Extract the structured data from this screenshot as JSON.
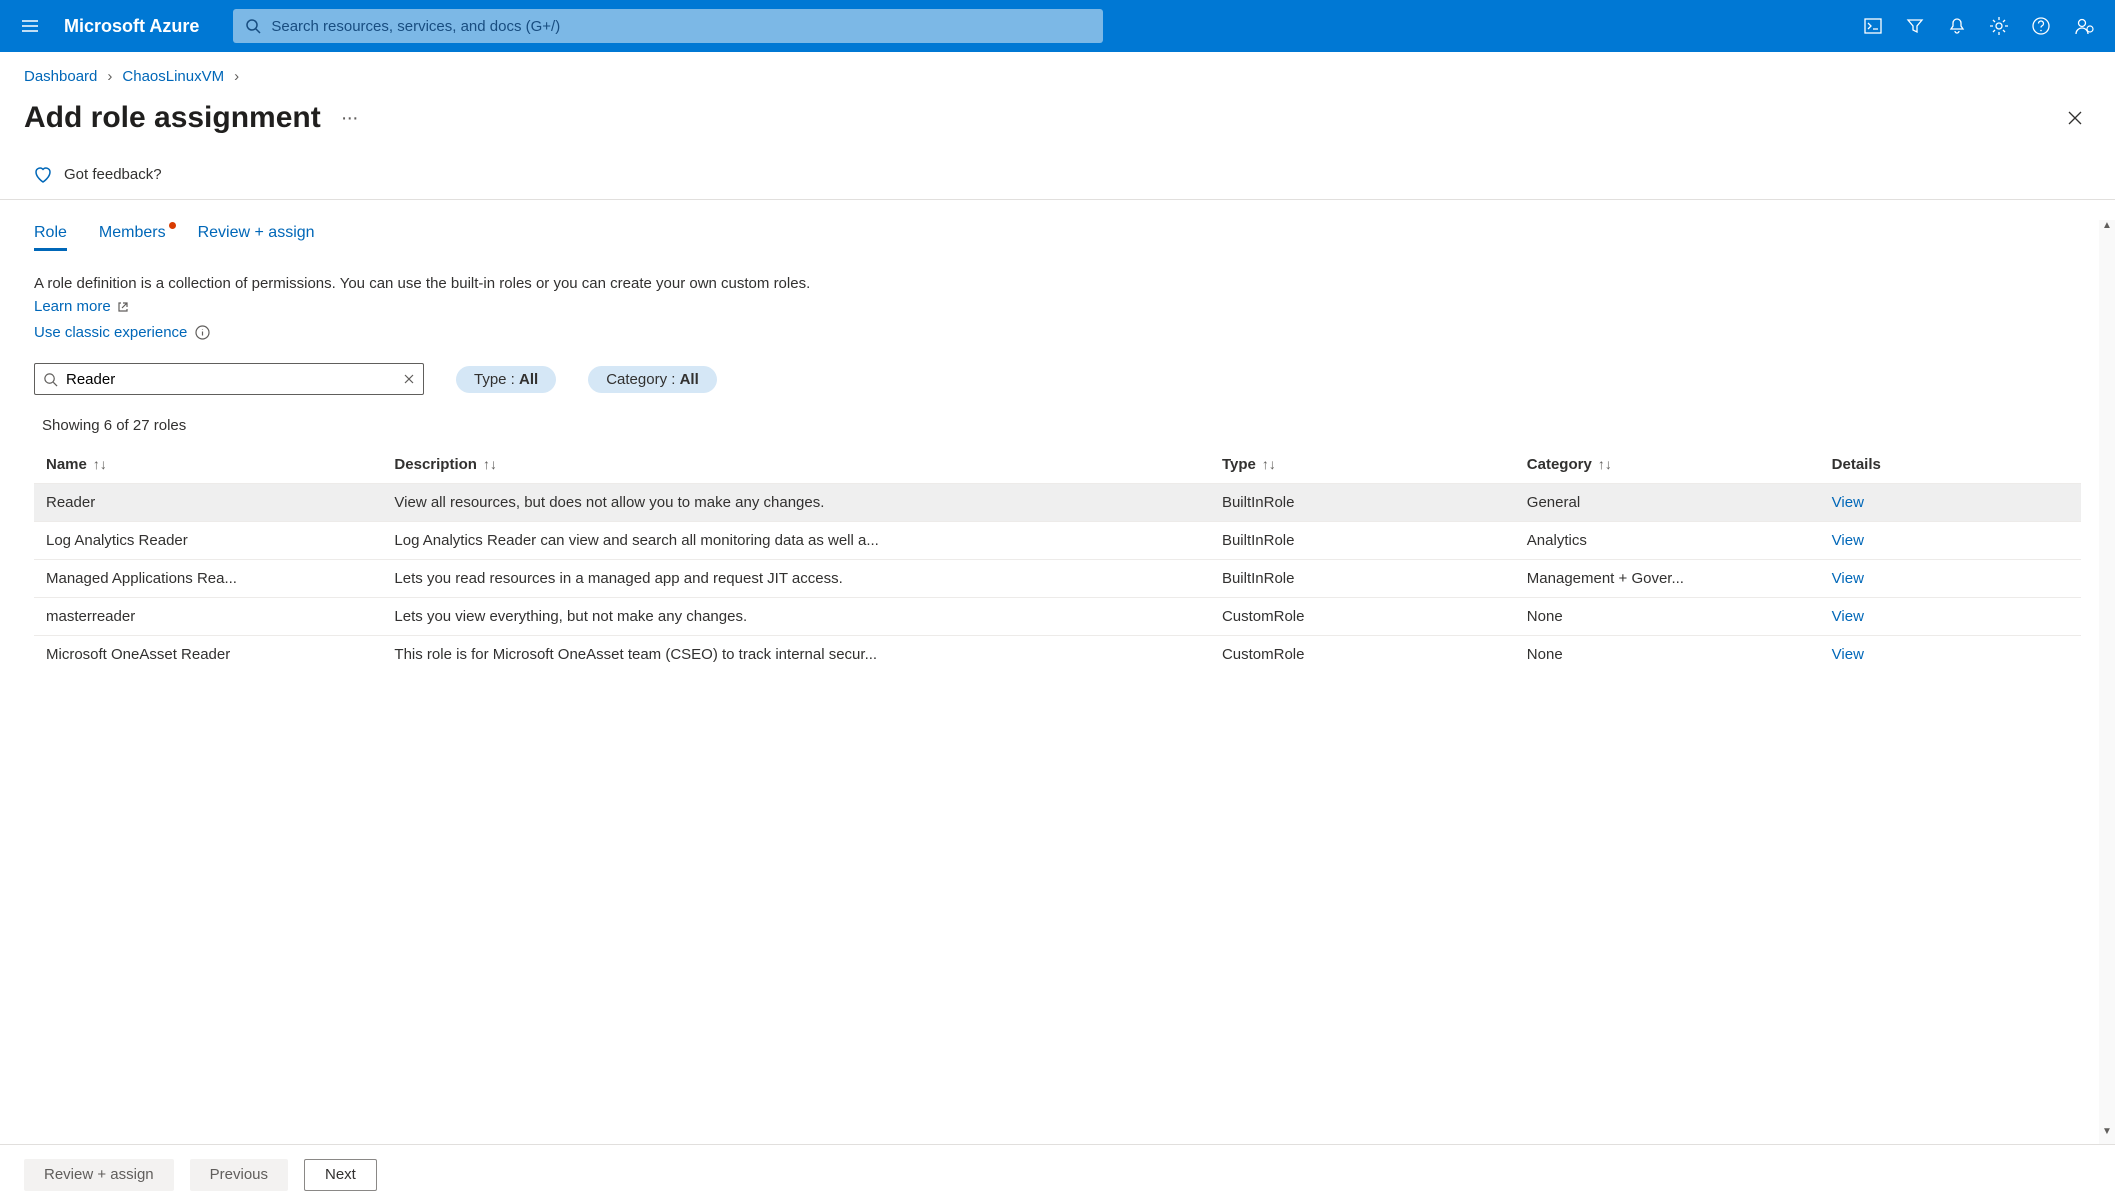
{
  "header": {
    "brand": "Microsoft Azure",
    "search_placeholder": "Search resources, services, and docs (G+/)"
  },
  "breadcrumb": {
    "items": [
      "Dashboard",
      "ChaosLinuxVM"
    ]
  },
  "page": {
    "title": "Add role assignment",
    "feedback": "Got feedback?"
  },
  "tabs": {
    "role": "Role",
    "members": "Members",
    "review": "Review + assign"
  },
  "intro": {
    "text_a": "A role definition is a collection of permissions. You can use the built-in roles or you can create your own custom roles. ",
    "learn_more": "Learn more",
    "classic": "Use classic experience"
  },
  "filters": {
    "search_value": "Reader",
    "type_label": "Type : ",
    "type_value": "All",
    "category_label": "Category : ",
    "category_value": "All"
  },
  "table": {
    "count_text": "Showing 6 of 27 roles",
    "cols": {
      "name": "Name",
      "desc": "Description",
      "type": "Type",
      "cat": "Category",
      "det": "Details"
    },
    "view": "View",
    "rows": [
      {
        "name": "Reader",
        "desc": "View all resources, but does not allow you to make any changes.",
        "type": "BuiltInRole",
        "cat": "General"
      },
      {
        "name": "Log Analytics Reader",
        "desc": "Log Analytics Reader can view and search all monitoring data as well a...",
        "type": "BuiltInRole",
        "cat": "Analytics"
      },
      {
        "name": "Managed Applications Rea...",
        "desc": "Lets you read resources in a managed app and request JIT access.",
        "type": "BuiltInRole",
        "cat": "Management + Gover..."
      },
      {
        "name": "masterreader",
        "desc": "Lets you view everything, but not make any changes.",
        "type": "CustomRole",
        "cat": "None"
      },
      {
        "name": "Microsoft OneAsset Reader",
        "desc": "This role is for Microsoft OneAsset team (CSEO) to track internal secur...",
        "type": "CustomRole",
        "cat": "None"
      }
    ]
  },
  "footer": {
    "review": "Review + assign",
    "prev": "Previous",
    "next": "Next"
  }
}
